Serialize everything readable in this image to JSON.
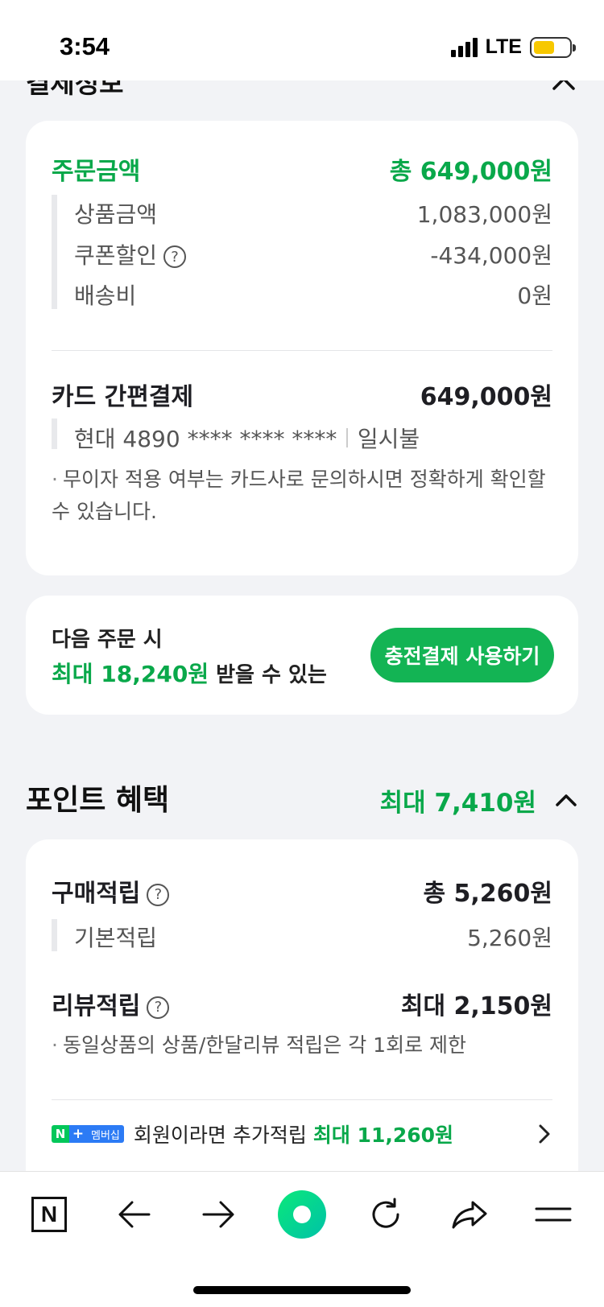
{
  "status": {
    "time": "3:54",
    "network": "LTE"
  },
  "header": {
    "partial_title": "결제정보"
  },
  "order": {
    "title": "주문금액",
    "total": "총 649,000원",
    "items": [
      {
        "label": "상품금액",
        "value": "1,083,000원"
      },
      {
        "label": "쿠폰할인",
        "value": "-434,000원"
      },
      {
        "label": "배송비",
        "value": "0원"
      }
    ],
    "payment_method": "카드 간편결제",
    "payment_amount": "649,000원",
    "card_info": "현대 4890 **** **** ****",
    "installment": "일시불",
    "note": "무이자 적용 여부는 카드사로 문의하시면 정확하게 확인할 수 있습니다."
  },
  "charge_promo": {
    "line1": "다음 주문 시",
    "amount": "최대 18,240원",
    "line2_suffix": "받을 수 있는",
    "button": "충전결제 사용하기"
  },
  "points": {
    "section_title": "포인트 혜택",
    "section_max": "최대 7,410원",
    "purchase_label": "구매적립",
    "purchase_total": "총 5,260원",
    "basic_label": "기본적립",
    "basic_value": "5,260원",
    "review_label": "리뷰적립",
    "review_value": "최대 2,150원",
    "review_note": "동일상품의 상품/한달리뷰 적립은 각 1회로 제한",
    "membership_badge_n": "N",
    "membership_badge_plus": "+",
    "membership_badge_text": "멤버십",
    "membership_text": "회원이라면 추가적립",
    "membership_amount": "최대 11,260원"
  },
  "icons": {
    "brand": "N",
    "question": "?"
  },
  "colors": {
    "accent_green": "#09a84a",
    "button_green": "#13b454",
    "membership_blue": "#2c7bf5"
  }
}
